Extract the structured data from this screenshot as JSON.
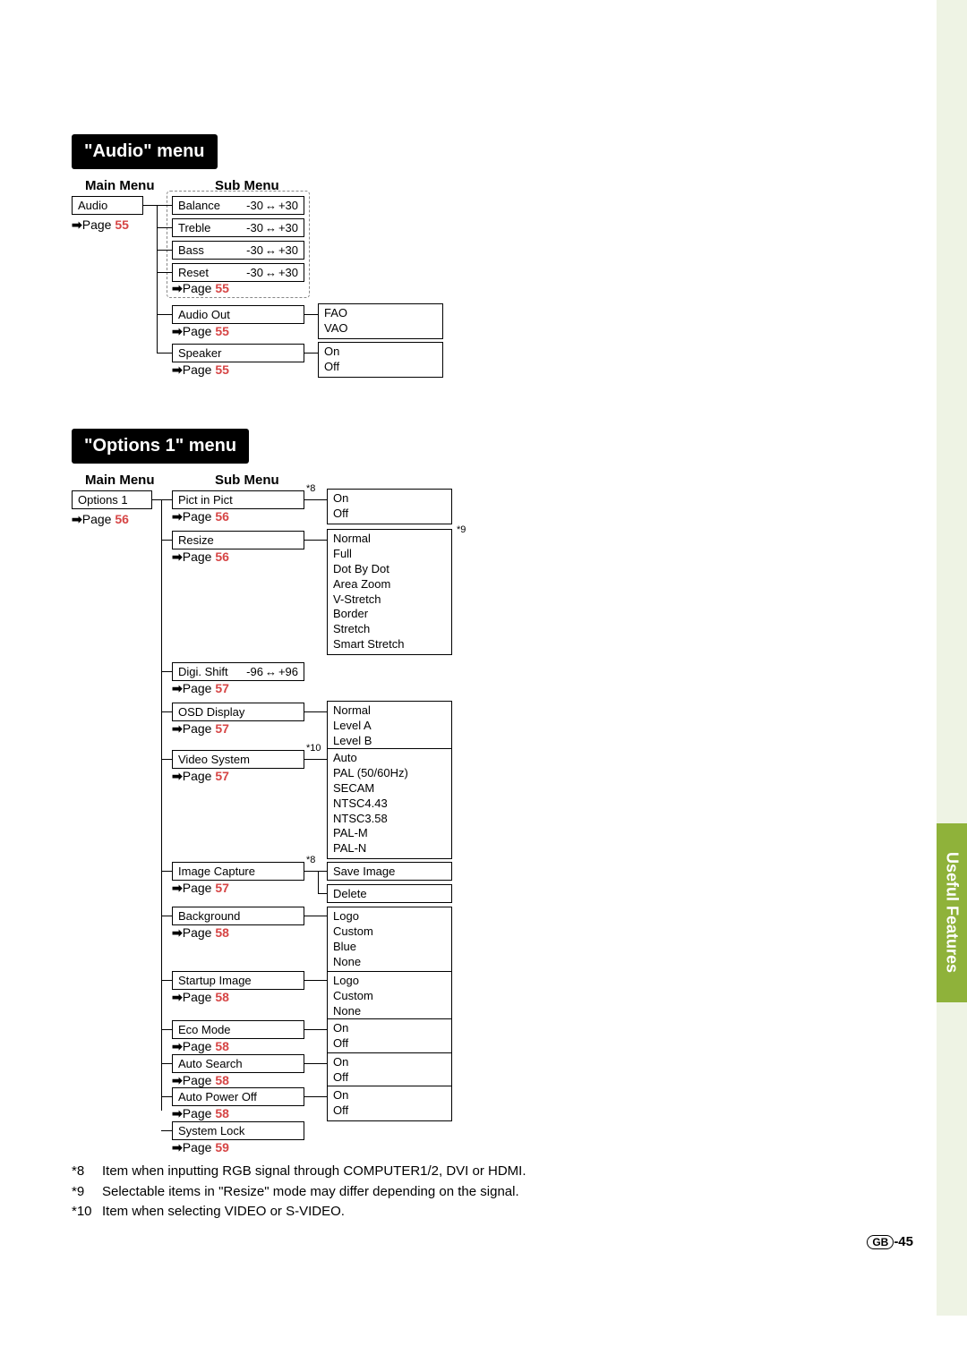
{
  "side_tab": "Useful Features",
  "page_number_prefix": "GB",
  "page_number": "-45",
  "audio_menu": {
    "title": "\"Audio\" menu",
    "col_main": "Main Menu",
    "col_sub": "Sub Menu",
    "main_label": "Audio",
    "main_page_label": "Page ",
    "main_page_num": "55",
    "sub_items": [
      {
        "label": "Balance",
        "range_l": "-30",
        "range_r": "+30"
      },
      {
        "label": "Treble",
        "range_l": "-30",
        "range_r": "+30"
      },
      {
        "label": "Bass",
        "range_l": "-30",
        "range_r": "+30"
      },
      {
        "label": "Reset",
        "range_l": "-30",
        "range_r": "+30"
      }
    ],
    "sub_group_page_label": "Page ",
    "sub_group_page_num": "55",
    "audio_out": {
      "label": "Audio Out",
      "page_label": "Page ",
      "page_num": "55",
      "options": [
        "FAO",
        "VAO"
      ]
    },
    "speaker": {
      "label": "Speaker",
      "page_label": "Page ",
      "page_num": "55",
      "options": [
        "On",
        "Off"
      ]
    }
  },
  "options1_menu": {
    "title": "\"Options 1\" menu",
    "col_main": "Main Menu",
    "col_sub": "Sub Menu",
    "main_label": "Options 1",
    "main_page_label": "Page ",
    "main_page_num": "56",
    "items": [
      {
        "label": "Pict in Pict",
        "page": "56",
        "fn": "*8",
        "options": [
          "On",
          "Off"
        ]
      },
      {
        "label": "Resize",
        "page": "56",
        "fn_right": "*9",
        "options": [
          "Normal",
          "Full",
          "Dot By Dot",
          "Area Zoom",
          "V-Stretch",
          "Border",
          "Stretch",
          "Smart Stretch"
        ]
      },
      {
        "label": "Digi. Shift",
        "range_l": "-96",
        "range_r": "+96",
        "page": "57"
      },
      {
        "label": "OSD Display",
        "page": "57",
        "options": [
          "Normal",
          "Level A",
          "Level B"
        ]
      },
      {
        "label": "Video System",
        "page": "57",
        "fn": "*10",
        "options": [
          "Auto",
          "PAL (50/60Hz)",
          "SECAM",
          "NTSC4.43",
          "NTSC3.58",
          "PAL-M",
          "PAL-N"
        ]
      },
      {
        "label": "Image Capture",
        "page": "57",
        "fn": "*8",
        "options": [
          "Save Image",
          "Delete"
        ]
      },
      {
        "label": "Background",
        "page": "58",
        "options": [
          "Logo",
          "Custom",
          "Blue",
          "None"
        ]
      },
      {
        "label": "Startup Image",
        "page": "58",
        "options": [
          "Logo",
          "Custom",
          "None"
        ]
      },
      {
        "label": "Eco Mode",
        "page": "58",
        "options": [
          "On",
          "Off"
        ]
      },
      {
        "label": "Auto Search",
        "page": "58",
        "options": [
          "On",
          "Off"
        ]
      },
      {
        "label": "Auto Power Off",
        "page": "58",
        "options": [
          "On",
          "Off"
        ]
      },
      {
        "label": "System Lock",
        "page": "59"
      }
    ]
  },
  "footnotes": [
    {
      "key": "*8",
      "text": "Item when inputting RGB signal through COMPUTER1/2, DVI or HDMI."
    },
    {
      "key": "*9",
      "text": "Selectable items in \"Resize\" mode may differ depending on the signal."
    },
    {
      "key": "*10",
      "text": "Item when selecting VIDEO or S-VIDEO."
    }
  ]
}
